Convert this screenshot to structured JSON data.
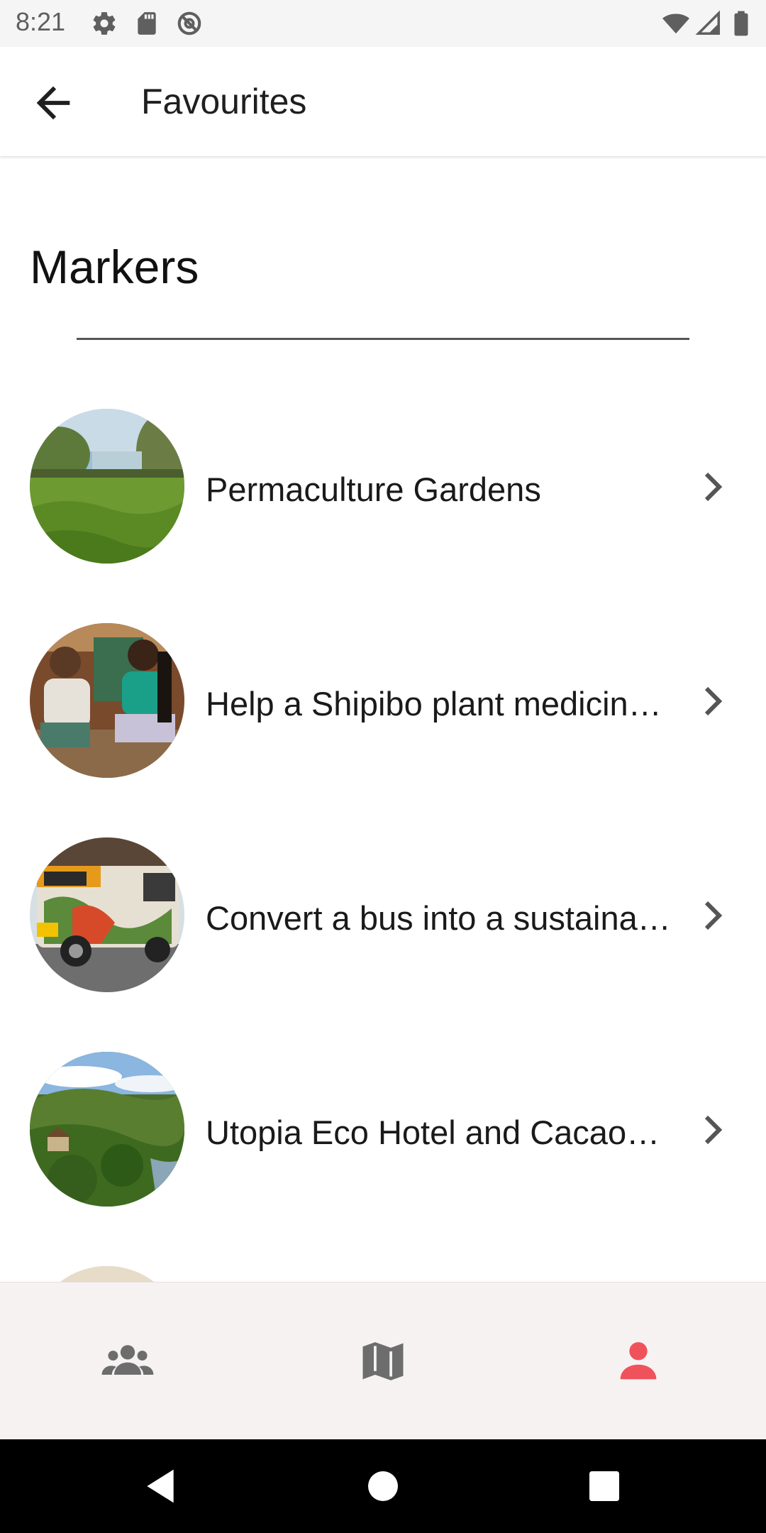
{
  "status_bar": {
    "time": "8:21",
    "icons": [
      "settings-icon",
      "sd-card-icon",
      "no-sync-icon",
      "wifi-icon",
      "signal-icon",
      "battery-icon"
    ]
  },
  "app_bar": {
    "title": "Favourites",
    "back_icon": "arrow-back-icon"
  },
  "section": {
    "title": "Markers"
  },
  "markers": [
    {
      "label": "Permaculture Gardens",
      "image": "garden-photo"
    },
    {
      "label": "Help a Shipibo plant medicin…",
      "image": "people-photo"
    },
    {
      "label": "Convert a bus into a sustaina…",
      "image": "bus-photo"
    },
    {
      "label": "Utopia Eco Hotel and Cacao…",
      "image": "jungle-photo"
    }
  ],
  "bottom_nav": {
    "items": [
      {
        "name": "community",
        "icon": "people-icon",
        "selected": false
      },
      {
        "name": "map",
        "icon": "map-icon",
        "selected": false
      },
      {
        "name": "profile",
        "icon": "person-icon",
        "selected": true
      }
    ],
    "accent_color": "#f0525c",
    "inactive_color": "#6d6d6d"
  },
  "system_nav": {
    "icons": [
      "back-triangle-icon",
      "home-circle-icon",
      "recents-square-icon"
    ]
  }
}
